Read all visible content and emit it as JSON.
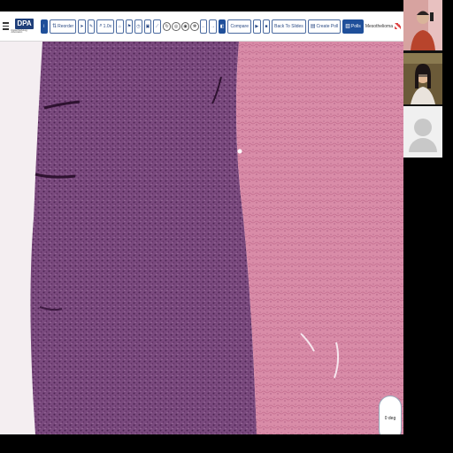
{
  "app": {
    "logo_text": "DPA",
    "logo_subtitle": "Digital Pathology Association"
  },
  "toolbar": {
    "reorder_label": "Reorder",
    "zoom_label": "1.0x",
    "compare_label": "Compare",
    "back_to_slides_label": "Back To Slides",
    "create_poll_label": "Create Poll",
    "polls_label": "Polls"
  },
  "slide": {
    "name": "Mesothelioma"
  },
  "viewer": {
    "rotation_label": "0 deg"
  },
  "participants": {
    "count_visible": 3
  }
}
